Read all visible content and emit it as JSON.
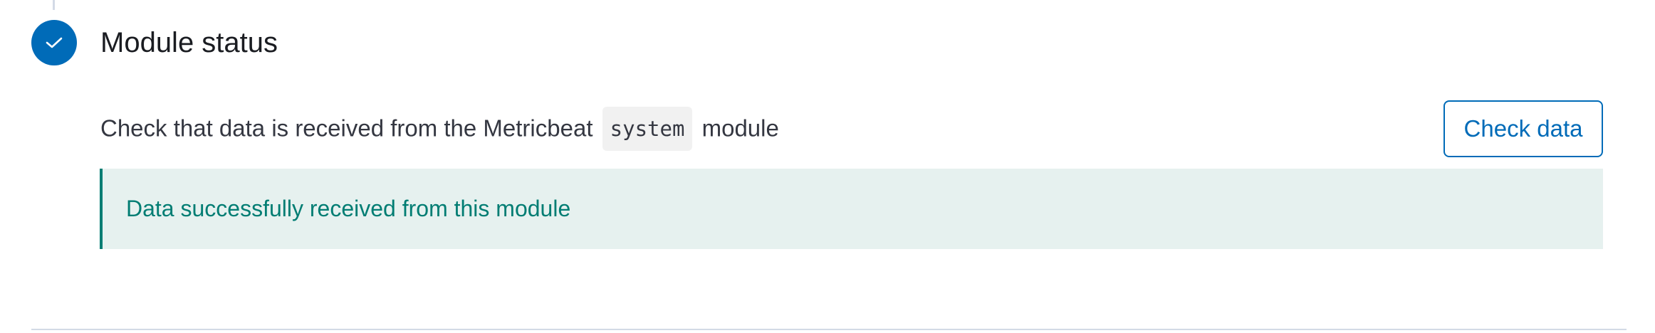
{
  "step": {
    "title": "Module status",
    "status_icon": "check-icon",
    "accent_color": "#006bb8"
  },
  "description": {
    "prefix": "Check that data is received from the Metricbeat",
    "module_code": "system",
    "suffix": "module"
  },
  "actions": {
    "check_data_label": "Check data"
  },
  "callout": {
    "message": "Data successfully received from this module",
    "color": "#017d73",
    "background": "#e6f1ef"
  }
}
